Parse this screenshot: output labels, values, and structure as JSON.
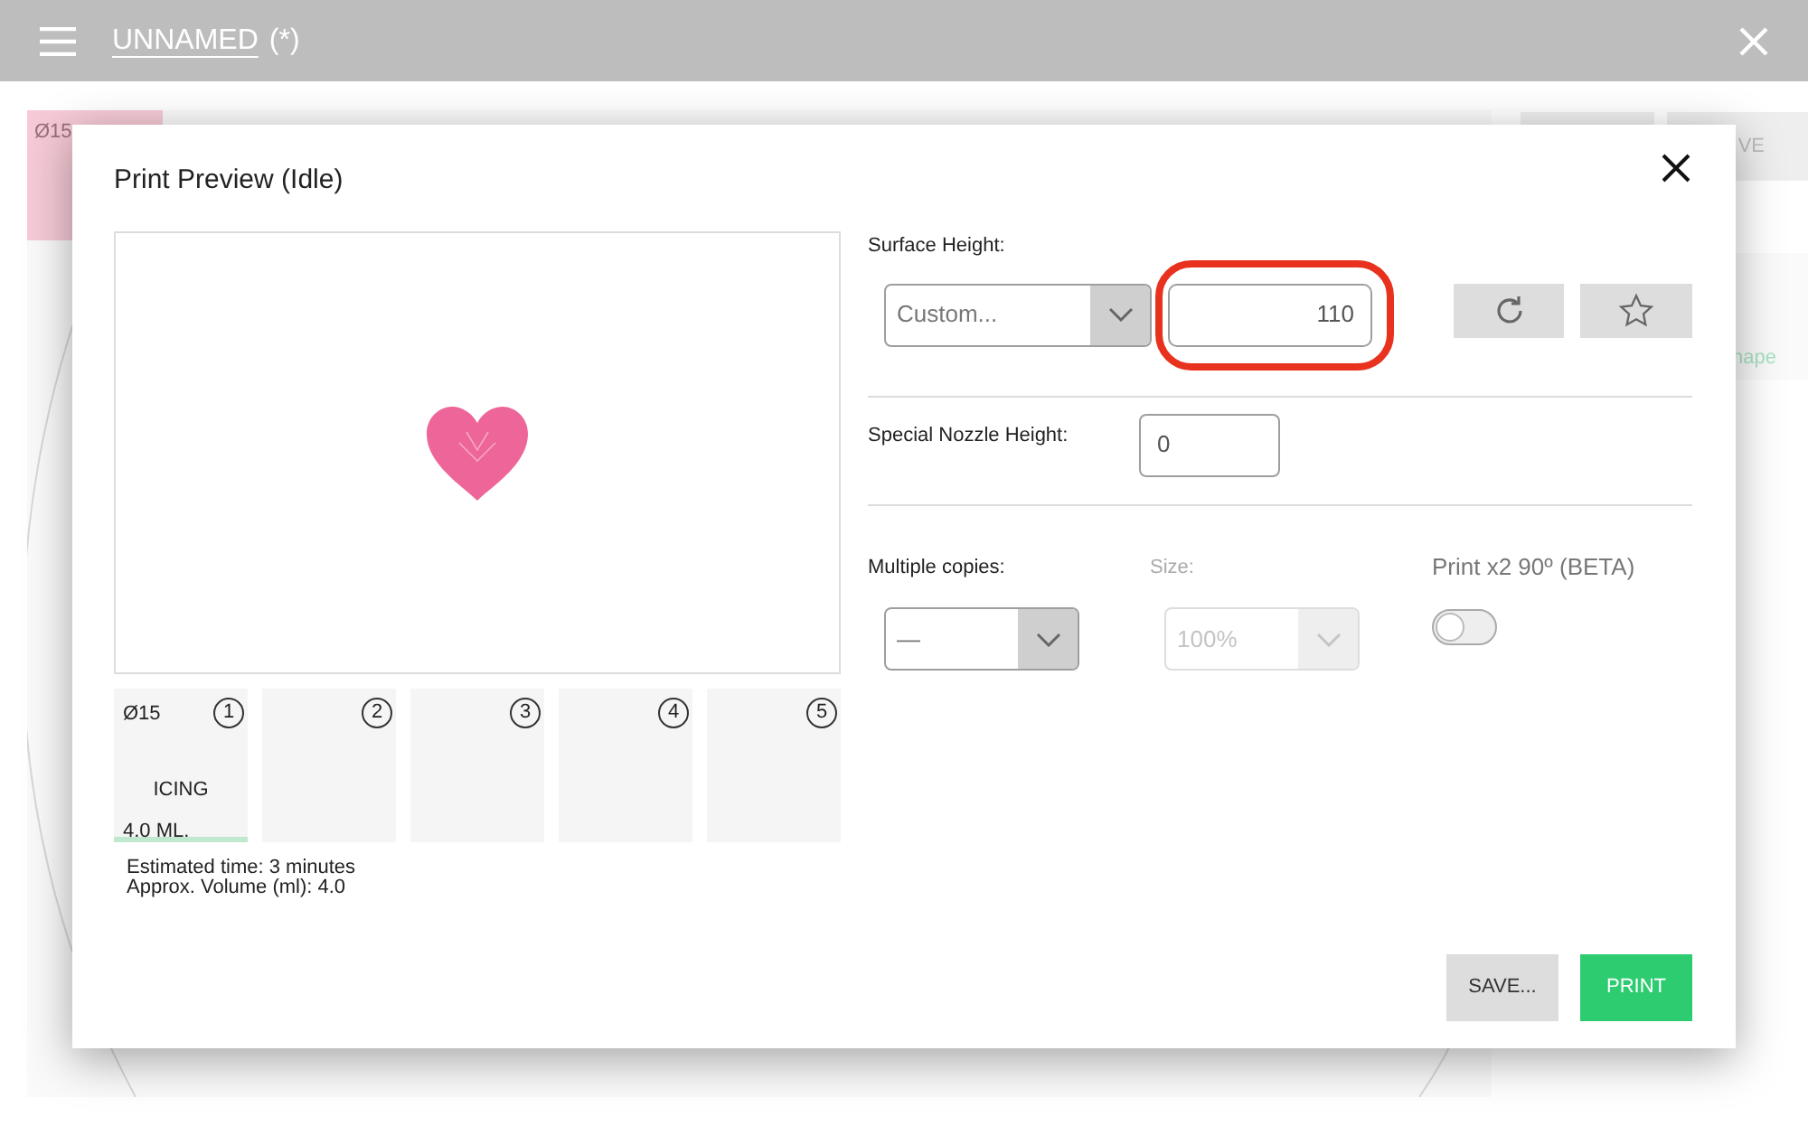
{
  "app_bar": {
    "title": "UNNAMED",
    "modified": "(*)"
  },
  "background": {
    "tile_label": "Ø15",
    "button_label": "VE",
    "shape_label": "hape"
  },
  "dialog": {
    "title": "Print Preview (Idle)",
    "slots": [
      {
        "number": "1",
        "diameter": "Ø15",
        "material": "ICING",
        "volume": "4.0 ML.",
        "selected": true
      },
      {
        "number": "2",
        "selected": false
      },
      {
        "number": "3",
        "selected": false
      },
      {
        "number": "4",
        "selected": false
      },
      {
        "number": "5",
        "selected": false
      }
    ],
    "estimates": [
      "Estimated time: 3 minutes",
      "Approx. Volume (ml): 4.0"
    ],
    "surface_height": {
      "label": "Surface Height:",
      "preset": "Custom...",
      "value": "110",
      "highlighted": true
    },
    "nozzle": {
      "label": "Special Nozzle Height:",
      "value": "0"
    },
    "copies": {
      "label": "Multiple copies:",
      "value": "—",
      "disabled": false
    },
    "size": {
      "label": "Size:",
      "value": "100%",
      "disabled": true
    },
    "rotate": {
      "label": "Print x2 90º (BETA)",
      "on": false
    },
    "buttons": [
      {
        "label": "SAVE...",
        "kind": "secondary"
      },
      {
        "label": "PRINT",
        "kind": "primary"
      }
    ]
  }
}
